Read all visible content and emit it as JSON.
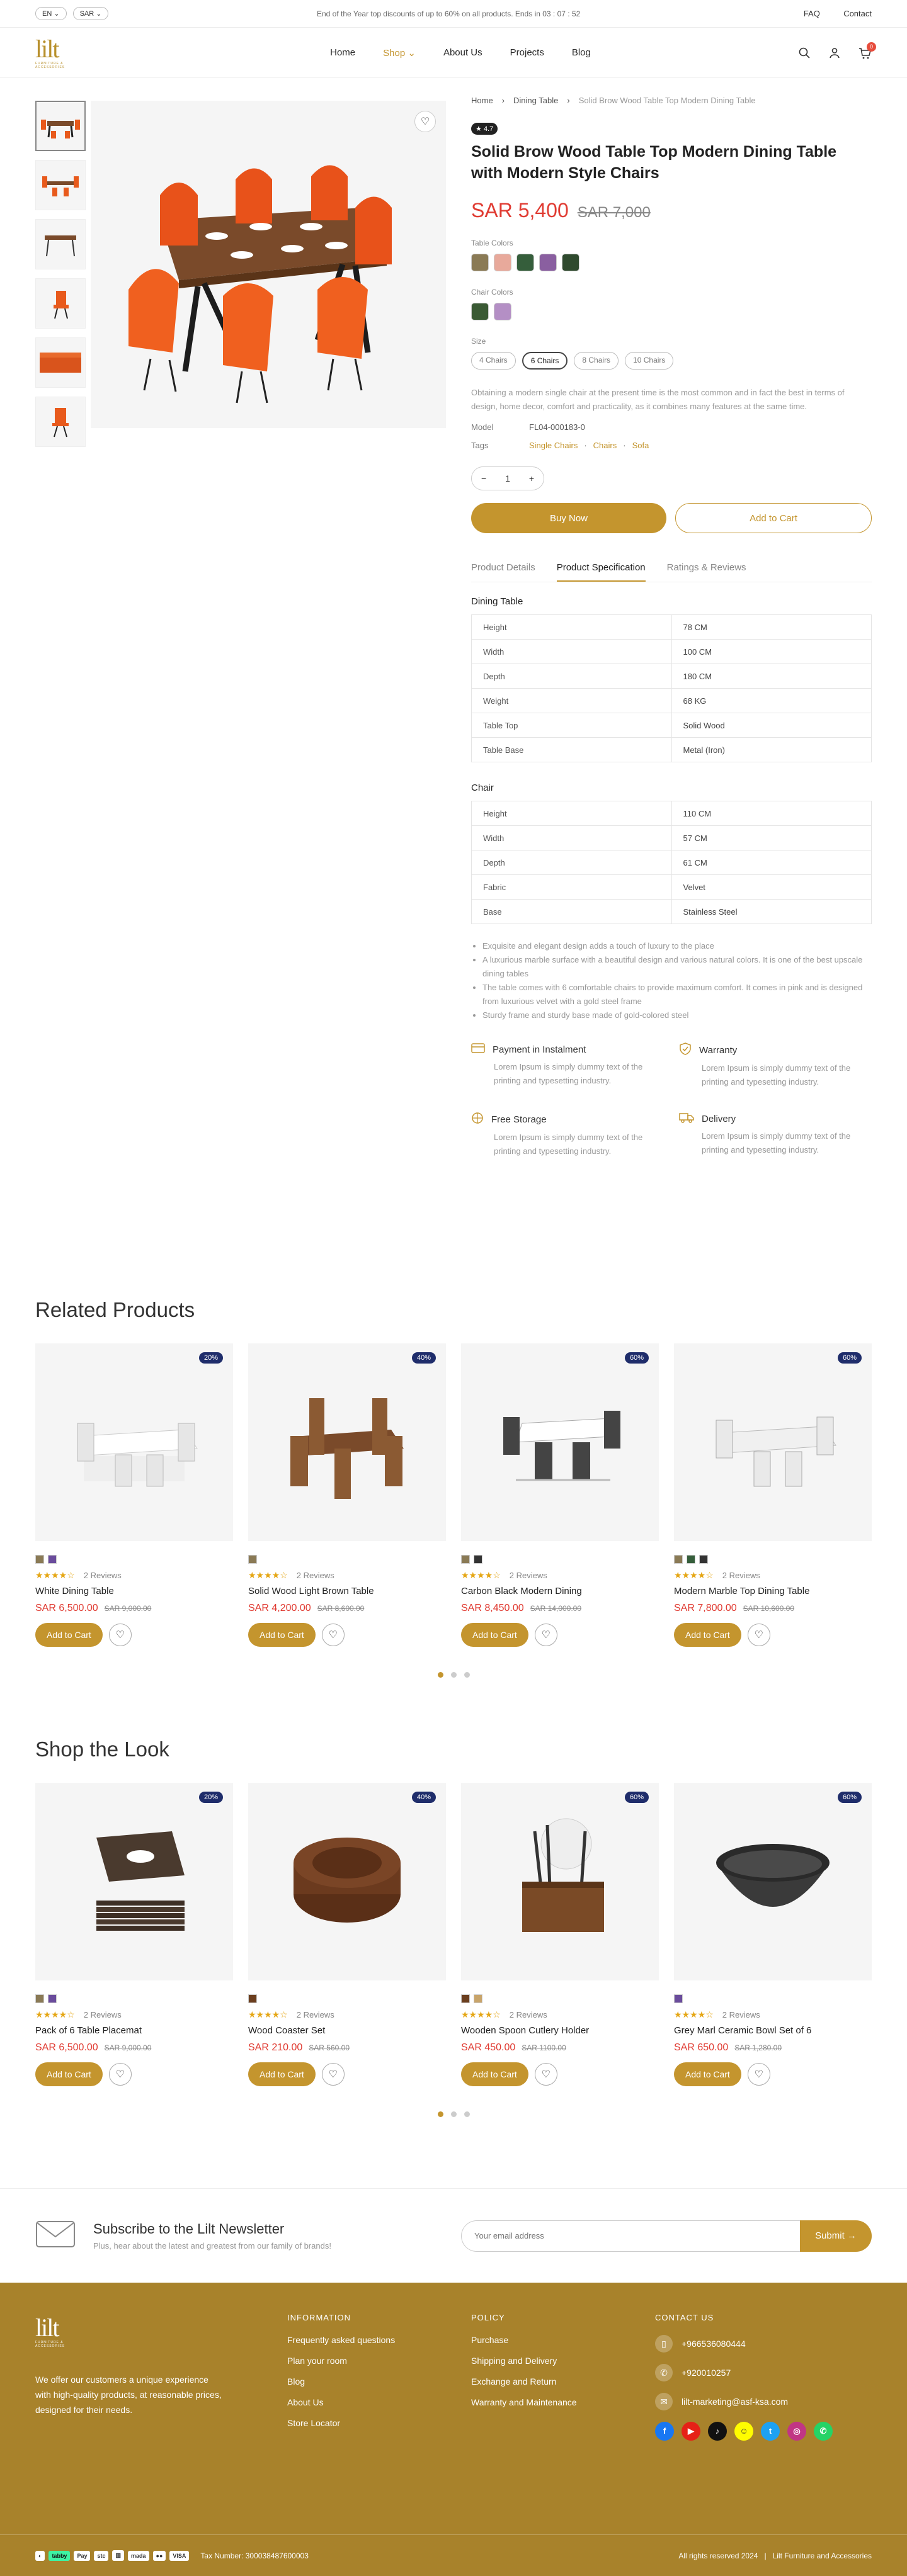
{
  "topbar": {
    "lang": "EN",
    "currency": "SAR",
    "promo": "End of the Year top discounts of up to 60% on all products. Ends in 03 : 07 : 52",
    "faq": "FAQ",
    "contact": "Contact"
  },
  "nav": {
    "logo": "lilt",
    "logo_sub": "FURNITURE & ACCESSORIES",
    "items": [
      "Home",
      "Shop",
      "About Us",
      "Projects",
      "Blog"
    ],
    "cart_count": "0"
  },
  "product": {
    "breadcrumb": [
      "Home",
      "Dining Table",
      "Solid Brow Wood Table Top Modern Dining Table"
    ],
    "rating": "4.7",
    "title": "Solid Brow Wood Table Top Modern Dining Table with Modern Style Chairs",
    "price": "SAR 5,400",
    "old_price": "SAR 7,000",
    "table_colors_label": "Table Colors",
    "table_colors": [
      "#8a7a55",
      "#e8a99b",
      "#355e3b",
      "#8a5fa0",
      "#2f4a2e"
    ],
    "chair_colors_label": "Chair Colors",
    "chair_colors": [
      "#3a5a34",
      "#b48fc5"
    ],
    "size_label": "Size",
    "sizes": [
      "4 Chairs",
      "6 Chairs",
      "8 Chairs",
      "10 Chairs"
    ],
    "description": "Obtaining a modern single chair at the present time is the most common and in fact the best in terms of design, home decor, comfort and practicality, as it combines many features at the same time.",
    "model_label": "Model",
    "model": "FL04-000183-0",
    "tags_label": "Tags",
    "tags": [
      "Single Chairs",
      "Chairs",
      "Sofa"
    ],
    "qty": "1",
    "buy_now": "Buy Now",
    "add_to_cart": "Add to Cart",
    "tabs": [
      "Product Details",
      "Product Specification",
      "Ratings & Reviews"
    ],
    "dining_title": "Dining Table",
    "dining_spec": [
      [
        "Height",
        "78 CM"
      ],
      [
        "Width",
        "100 CM"
      ],
      [
        "Depth",
        "180 CM"
      ],
      [
        "Weight",
        "68 KG"
      ],
      [
        "Table Top",
        "Solid Wood"
      ],
      [
        "Table Base",
        "Metal (Iron)"
      ]
    ],
    "chair_title": "Chair",
    "chair_spec": [
      [
        "Height",
        "110 CM"
      ],
      [
        "Width",
        "57 CM"
      ],
      [
        "Depth",
        "61 CM"
      ],
      [
        "Fabric",
        "Velvet"
      ],
      [
        "Base",
        "Stainless Steel"
      ]
    ],
    "bullets": [
      "Exquisite and elegant design adds a touch of luxury to the place",
      "A luxurious marble surface with a beautiful design and various natural colors. It is one of the best upscale dining tables",
      "The table comes with 6 comfortable chairs to provide maximum comfort. It comes in pink and is designed from luxurious velvet with a gold steel frame",
      "Sturdy frame and sturdy base made of gold-colored steel"
    ],
    "features": [
      {
        "title": "Payment in Instalment",
        "desc": "Lorem Ipsum is simply dummy text of the printing and typesetting industry.",
        "icon": "card-icon"
      },
      {
        "title": "Warranty",
        "desc": "Lorem Ipsum is simply dummy text of the printing and typesetting industry.",
        "icon": "shield-icon"
      },
      {
        "title": "Free Storage",
        "desc": "Lorem Ipsum is simply dummy text of the printing and typesetting industry.",
        "icon": "box-icon"
      },
      {
        "title": "Delivery",
        "desc": "Lorem Ipsum is simply dummy text of the printing and typesetting industry.",
        "icon": "truck-icon"
      }
    ]
  },
  "related": {
    "title": "Related Products",
    "items": [
      {
        "name": "White Dining Table",
        "price": "SAR 6,500.00",
        "old": "SAR 9,000.00",
        "disc": "20%",
        "reviews": "2 Reviews",
        "colors": [
          "#8a7a55",
          "#6a4c9c"
        ]
      },
      {
        "name": "Solid Wood Light Brown Table",
        "price": "SAR 4,200.00",
        "old": "SAR 8,600.00",
        "disc": "40%",
        "reviews": "2 Reviews",
        "colors": [
          "#8a7a55"
        ]
      },
      {
        "name": "Carbon Black Modern Dining",
        "price": "SAR 8,450.00",
        "old": "SAR 14,000.00",
        "disc": "60%",
        "reviews": "2 Reviews",
        "colors": [
          "#8a7a55",
          "#333"
        ]
      },
      {
        "name": "Modern Marble Top Dining Table",
        "price": "SAR 7,800.00",
        "old": "SAR 10,600.00",
        "disc": "60%",
        "reviews": "2 Reviews",
        "colors": [
          "#8a7a55",
          "#355e3b",
          "#333"
        ]
      }
    ]
  },
  "look": {
    "title": "Shop the Look",
    "items": [
      {
        "name": "Pack of 6 Table Placemat",
        "price": "SAR 6,500.00",
        "old": "SAR 9,000.00",
        "disc": "20%",
        "reviews": "2 Reviews",
        "colors": [
          "#8a7a55",
          "#6a4c9c"
        ]
      },
      {
        "name": "Wood Coaster Set",
        "price": "SAR 210.00",
        "old": "SAR 560.00",
        "disc": "40%",
        "reviews": "2 Reviews",
        "colors": [
          "#6b3e1e"
        ]
      },
      {
        "name": "Wooden Spoon Cutlery Holder",
        "price": "SAR 450.00",
        "old": "SAR 1100.00",
        "disc": "60%",
        "reviews": "2 Reviews",
        "colors": [
          "#6b3e1e",
          "#c8a46a"
        ]
      },
      {
        "name": "Grey Marl Ceramic Bowl Set of 6",
        "price": "SAR 650.00",
        "old": "SAR 1,280.00",
        "disc": "60%",
        "reviews": "2 Reviews",
        "colors": [
          "#6a4c9c"
        ]
      }
    ]
  },
  "card_btn": "Add to Cart",
  "newsletter": {
    "title": "Subscribe to the Lilt Newsletter",
    "sub": "Plus, hear about the latest and greatest from our family of brands!",
    "placeholder": "Your email address",
    "button": "Submit"
  },
  "footer": {
    "about": "We offer our customers a unique experience with high-quality products, at reasonable prices, designed for their needs.",
    "info_title": "INFORMATION",
    "info": [
      "Frequently asked questions",
      "Plan your room",
      "Blog",
      "About Us",
      "Store Locator"
    ],
    "policy_title": "POLICY",
    "policy": [
      "Purchase",
      "Shipping and Delivery",
      "Exchange and Return",
      "Warranty and Maintenance"
    ],
    "contact_title": "CONTACT US",
    "phone": "+966536080444",
    "phone2": "+920010257",
    "email": "lilt-marketing@asf-ksa.com",
    "tax": "Tax Number: 300038487600003",
    "rights": "All rights reserved 2024",
    "company": "Lilt Furniture and Accessories"
  }
}
